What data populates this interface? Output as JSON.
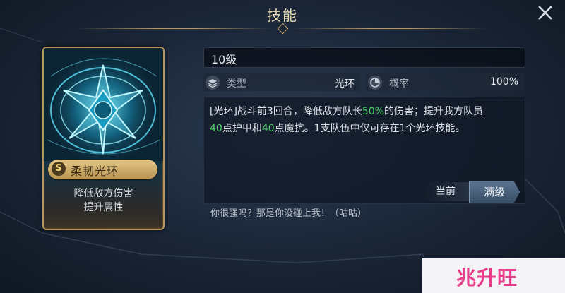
{
  "header": {
    "title": "技能"
  },
  "card": {
    "rank": "S",
    "skill_name": "柔韧光环",
    "desc_line1": "降低敌方伤害",
    "desc_line2": "提升属性"
  },
  "level": "10级",
  "attributes": [
    {
      "label": "类型",
      "value": "光环",
      "icon": "stack-layers-icon"
    },
    {
      "label": "概率",
      "value": "100%",
      "icon": "probability-pie-icon"
    }
  ],
  "description": {
    "p1": "[光环]战斗前3回合，降低敌方队长",
    "p2": "50%",
    "p3": "的伤害；提升我方队员",
    "p4": "40",
    "p5": "点护甲和",
    "p6": "40",
    "p7": "点魔抗。1支队伍中仅可存在1个光环技能。"
  },
  "tabs": {
    "current": "当前",
    "max": "满级"
  },
  "quote": "你很强吗？那是你没碰上我！（咕咕）",
  "watermark": "兆升旺",
  "colors": {
    "highlight": "#52d16b",
    "gold": "#c8a86a",
    "watermark": "#e83d8a"
  }
}
